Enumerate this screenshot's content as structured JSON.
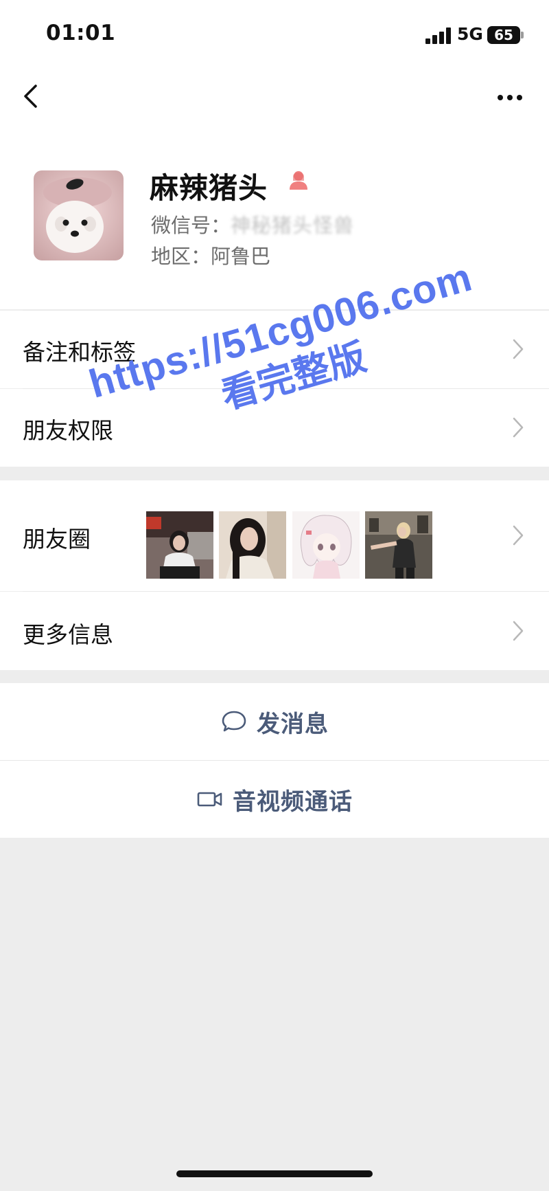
{
  "status_bar": {
    "time": "01:01",
    "network": "5G",
    "battery": "65"
  },
  "nav": {
    "back_icon": "chevron-left-icon",
    "more_icon": "more-dots-icon"
  },
  "profile": {
    "name": "麻辣猪头",
    "gender_icon": "female-user-icon",
    "wechat_id_label": "微信号：",
    "wechat_id_value": "神秘猪头怪兽",
    "region_label": "地区：",
    "region_value": "阿鲁巴"
  },
  "menu": {
    "remarks_tags": "备注和标签",
    "friend_permissions": "朋友权限",
    "moments": "朋友圈",
    "more_info": "更多信息"
  },
  "actions": {
    "send_message": "发消息",
    "voice_video_call": "音视频通话"
  },
  "watermark": {
    "url": "https://51cg006.com",
    "text": "看完整版"
  },
  "colors": {
    "action_text": "#4b5b79",
    "watermark": "#5a78ee",
    "background": "#ededed",
    "female_icon": "#f08080"
  }
}
